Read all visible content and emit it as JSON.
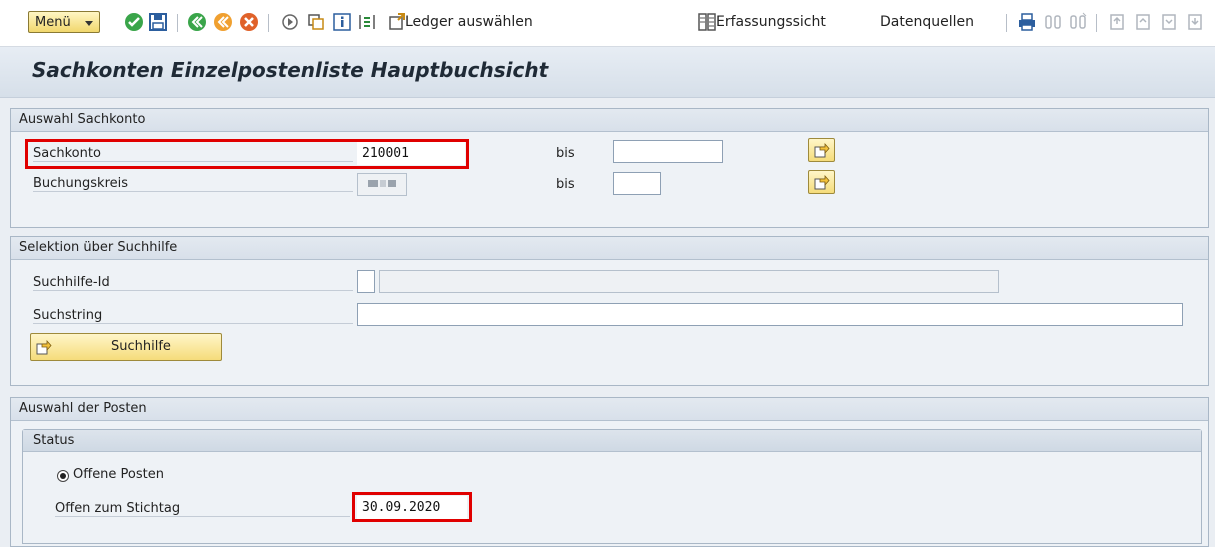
{
  "toolbar": {
    "menu_label": "Menü",
    "ledger_label": "Ledger auswählen",
    "entry_view_label": "Erfassungssicht",
    "data_sources_label": "Datenquellen"
  },
  "title": "Sachkonten Einzelpostenliste Hauptbuchsicht",
  "account_selection": {
    "heading": "Auswahl Sachkonto",
    "gl_account_label": "Sachkonto",
    "gl_account_value": "210001",
    "company_code_label": "Buchungskreis",
    "to_label_1": "bis",
    "to_label_2": "bis"
  },
  "search_help": {
    "heading": "Selektion über Suchhilfe",
    "id_label": "Suchhilfe-Id",
    "string_label": "Suchstring",
    "button_label": "Suchhilfe"
  },
  "item_selection": {
    "heading": "Auswahl der Posten",
    "status_heading": "Status",
    "open_items_label": "Offene Posten",
    "open_at_key_date_label": "Offen zum Stichtag",
    "key_date_value": "30.09.2020"
  },
  "colors": {
    "highlight": "#e00000",
    "button_yellow": "#f5dc7a"
  }
}
